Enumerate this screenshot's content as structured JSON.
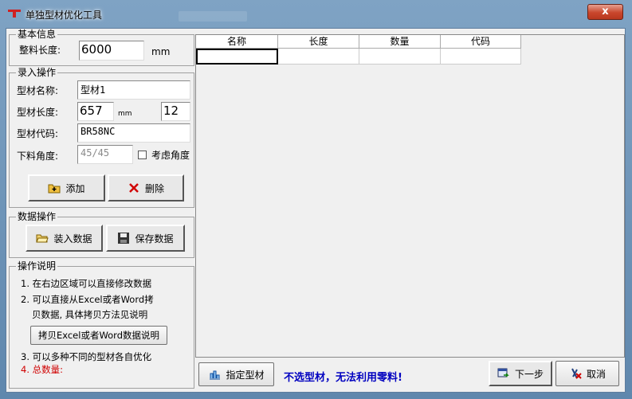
{
  "window": {
    "title": "单独型材优化工具",
    "close_label": "x"
  },
  "basic_info": {
    "legend": "基本信息",
    "length_label": "整料长度:",
    "length_value": "6000",
    "length_unit": "mm"
  },
  "entry": {
    "legend": "录入操作",
    "name_label": "型材名称:",
    "name_value": "型材1",
    "len_label": "型材长度:",
    "len_value": "657",
    "len_unit": "mm",
    "qty_value": "12",
    "code_label": "型材代码:",
    "code_value": "BR58NC",
    "angle_label": "下料角度:",
    "angle_value": "45/45",
    "angle_check_label": "考虑角度",
    "add_label": "添加",
    "delete_label": "删除"
  },
  "data_ops": {
    "legend": "数据操作",
    "load_label": "装入数据",
    "save_label": "保存数据"
  },
  "instructions": {
    "legend": "操作说明",
    "line1": "1. 在右边区域可以直接修改数据",
    "line2a": "2. 可以直接从Excel或者Word拷",
    "line2b": "贝数据, 具体拷贝方法见说明",
    "copy_button": "拷贝Excel或者Word数据说明",
    "line3": "3. 可以多种不同的型材各自优化",
    "line4": "4. 总数量:"
  },
  "table": {
    "columns": [
      "名称",
      "长度",
      "数量",
      "代码"
    ],
    "rows": [
      [
        "",
        "",
        "",
        ""
      ]
    ]
  },
  "footer": {
    "specify_label": "指定型材",
    "warning": "不选型材，无法利用零料!",
    "next_label": "下一步",
    "cancel_label": "取消"
  },
  "colors": {
    "accent": "#0000c0",
    "warning_red": "#d00000",
    "titlebar": "#6f95ba"
  }
}
